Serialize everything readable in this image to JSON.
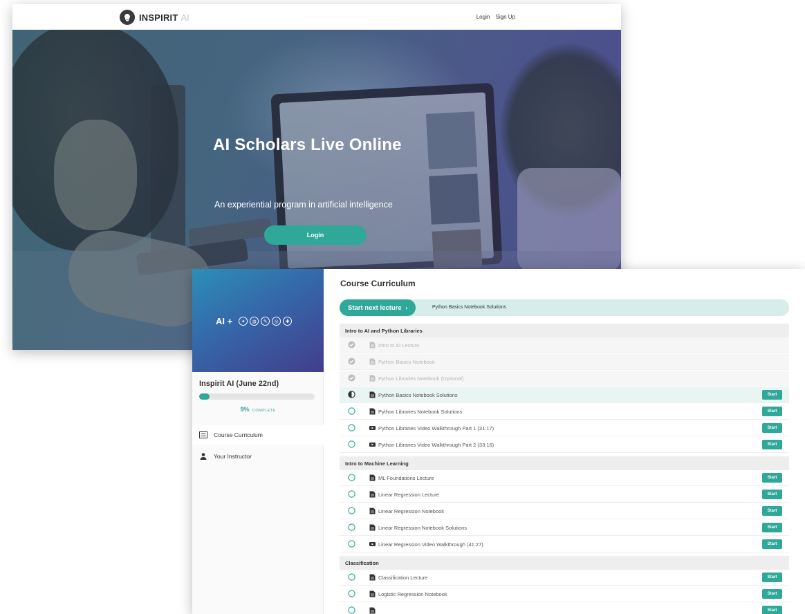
{
  "landing": {
    "logo_text": "INSPIRIT",
    "logo_text_ai": "AI",
    "nav": {
      "login": "Login",
      "signup": "Sign Up"
    },
    "hero_title": "AI Scholars Live Online",
    "hero_subtitle": "An experiential program in artificial intelligence",
    "hero_button": "Login"
  },
  "course": {
    "banner_text": "AI +",
    "banner_icons": [
      "brain-icon",
      "globe-icon",
      "chat-icon",
      "target-icon",
      "chart-icon"
    ],
    "name": "Inspirit AI (June 22nd)",
    "progress_percent": 9,
    "progress_value": "9%",
    "progress_suffix": "COMPLETE",
    "sidebar": [
      {
        "label": "Course Curriculum",
        "icon": "list-icon",
        "active": true
      },
      {
        "label": "Your Instructor",
        "icon": "user-icon",
        "active": false
      }
    ],
    "title": "Course Curriculum",
    "next_button": "Start next lecture",
    "next_lecture": "Python Basics Notebook Solutions",
    "start_label": "Start",
    "colors": {
      "accent": "#2fa89a",
      "accent_light": "#d6ede9",
      "section_bg": "#eeeeee"
    },
    "sections": [
      {
        "title": "Intro to AI and Python Libraries",
        "lectures": [
          {
            "label": "Intro to AI Lecture",
            "type": "document",
            "status": "completed"
          },
          {
            "label": "Python Basics Notebook",
            "type": "document",
            "status": "completed"
          },
          {
            "label": "Python Libraries Notebook (Optional)",
            "type": "document",
            "status": "completed"
          },
          {
            "label": "Python Basics Notebook Solutions",
            "type": "document",
            "status": "in-progress"
          },
          {
            "label": "Python Libraries Notebook Solutions",
            "type": "document",
            "status": "not-started"
          },
          {
            "label": "Python Libraries Video Walkthrough Part 1 (31:17)",
            "type": "video",
            "status": "not-started"
          },
          {
            "label": "Python Libraries Video Walkthrough Part 2 (33:16)",
            "type": "video",
            "status": "not-started"
          }
        ]
      },
      {
        "title": "Intro to Machine Learning",
        "lectures": [
          {
            "label": "ML Foundations Lecture",
            "type": "document",
            "status": "not-started"
          },
          {
            "label": "Linear Regression Lecture",
            "type": "document",
            "status": "not-started"
          },
          {
            "label": "Linear Regression Notebook",
            "type": "document",
            "status": "not-started"
          },
          {
            "label": "Linear Regression Notebook Solutions",
            "type": "document",
            "status": "not-started"
          },
          {
            "label": "Linear Regression Video Walkthrough (41:27)",
            "type": "video",
            "status": "not-started"
          }
        ]
      },
      {
        "title": "Classification",
        "lectures": [
          {
            "label": "Classification Lecture",
            "type": "document",
            "status": "not-started"
          },
          {
            "label": "Logistic Regression Notebook",
            "type": "document",
            "status": "not-started"
          },
          {
            "label": "",
            "type": "document",
            "status": "not-started"
          }
        ]
      }
    ]
  }
}
